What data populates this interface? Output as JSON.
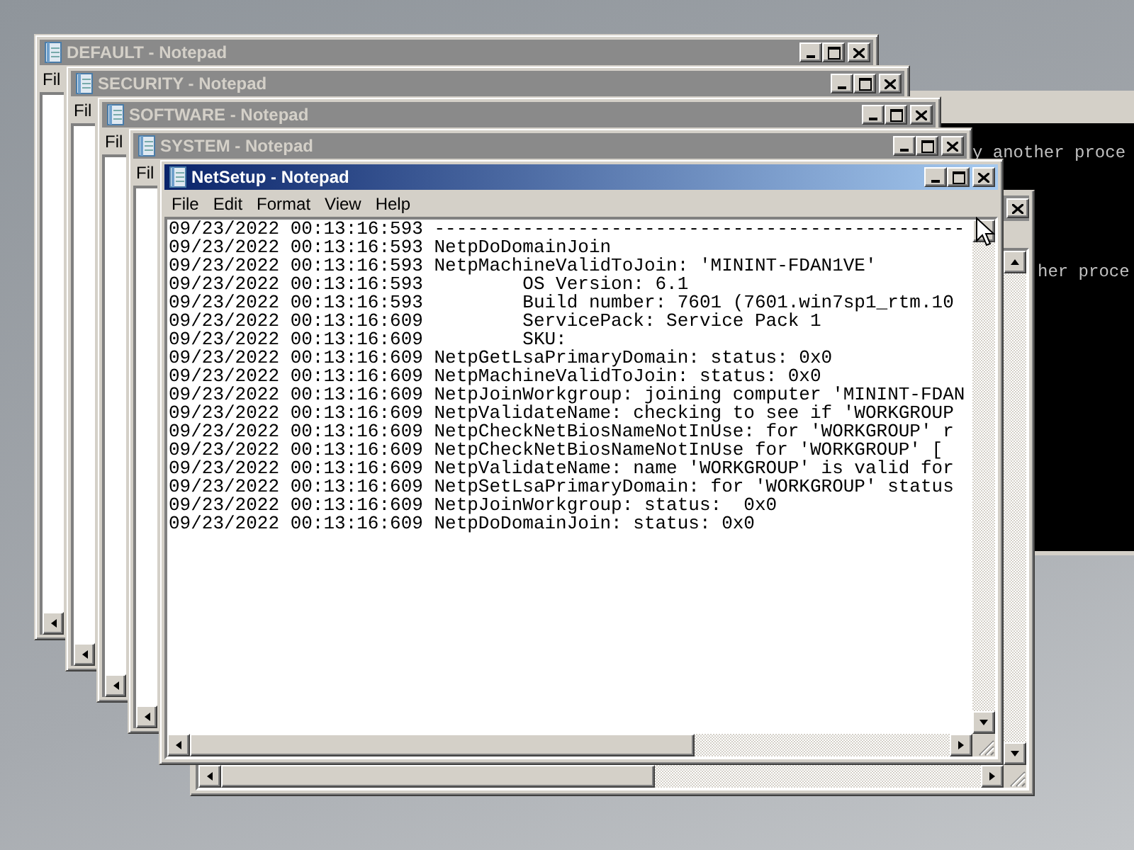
{
  "console": {
    "lines": [
      "y another proce",
      "her proce"
    ]
  },
  "windows": [
    {
      "title": "DEFAULT - Notepad",
      "active": false,
      "menu": [
        "Fil"
      ]
    },
    {
      "title": "SECURITY - Notepad",
      "active": false,
      "menu": [
        "Fil"
      ]
    },
    {
      "title": "SOFTWARE - Notepad",
      "active": false,
      "menu": [
        "Fil"
      ]
    },
    {
      "title": "SYSTEM - Notepad",
      "active": false,
      "menu": [
        "Fil"
      ]
    },
    {
      "title": "NetSetup - Notepad",
      "active": true,
      "menu": [
        "File",
        "Edit",
        "Format",
        "View",
        "Help"
      ],
      "lines": [
        "09/23/2022 00:13:16:593 ------------------------------------------------",
        "09/23/2022 00:13:16:593 NetpDoDomainJoin",
        "09/23/2022 00:13:16:593 NetpMachineValidToJoin: 'MININT-FDAN1VE'",
        "09/23/2022 00:13:16:593         OS Version: 6.1",
        "09/23/2022 00:13:16:593         Build number: 7601 (7601.win7sp1_rtm.10",
        "09/23/2022 00:13:16:609         ServicePack: Service Pack 1",
        "09/23/2022 00:13:16:609         SKU:",
        "09/23/2022 00:13:16:609 NetpGetLsaPrimaryDomain: status: 0x0",
        "09/23/2022 00:13:16:609 NetpMachineValidToJoin: status: 0x0",
        "09/23/2022 00:13:16:609 NetpJoinWorkgroup: joining computer 'MININT-FDAN",
        "09/23/2022 00:13:16:609 NetpValidateName: checking to see if 'WORKGROUP",
        "09/23/2022 00:13:16:609 NetpCheckNetBiosNameNotInUse: for 'WORKGROUP' r",
        "09/23/2022 00:13:16:609 NetpCheckNetBiosNameNotInUse for 'WORKGROUP' [",
        "09/23/2022 00:13:16:609 NetpValidateName: name 'WORKGROUP' is valid for",
        "09/23/2022 00:13:16:609 NetpSetLsaPrimaryDomain: for 'WORKGROUP' status",
        "09/23/2022 00:13:16:609 NetpJoinWorkgroup: status:  0x0",
        "09/23/2022 00:13:16:609 NetpDoDomainJoin: status: 0x0"
      ]
    }
  ]
}
